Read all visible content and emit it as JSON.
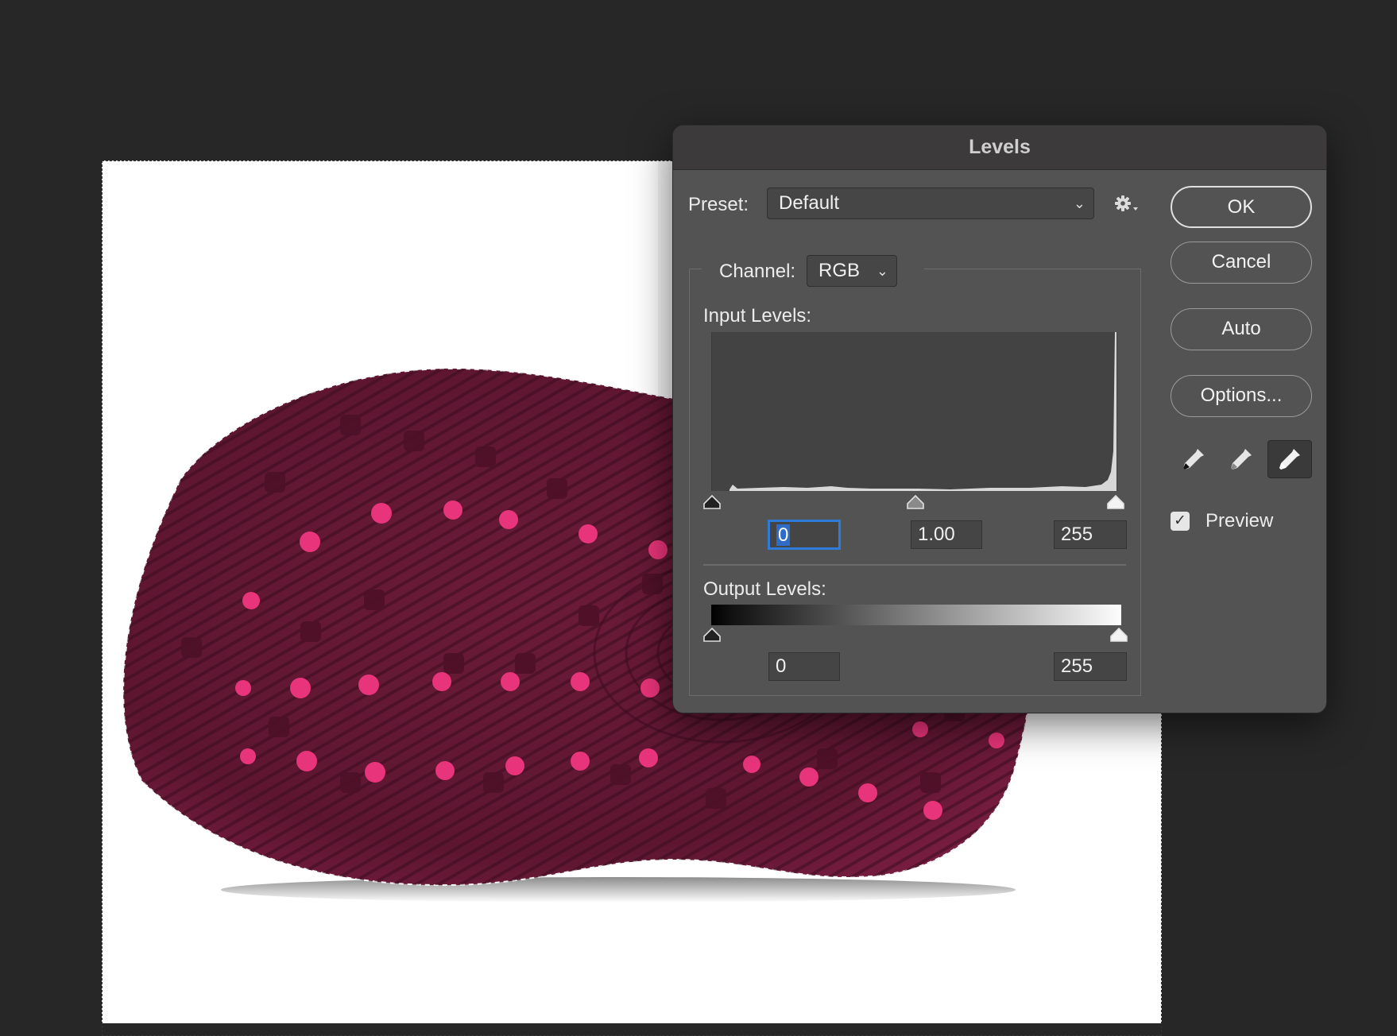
{
  "dialog": {
    "title": "Levels",
    "preset_label": "Preset:",
    "preset_value": "Default",
    "channel_label": "Channel:",
    "channel_value": "RGB",
    "input_levels_label": "Input Levels:",
    "input_black": "0",
    "input_gamma": "1.00",
    "input_white": "255",
    "output_levels_label": "Output Levels:",
    "output_black": "0",
    "output_white": "255",
    "buttons": {
      "ok": "OK",
      "cancel": "Cancel",
      "auto": "Auto",
      "options": "Options..."
    },
    "preview_label": "Preview",
    "preview_checked": true,
    "icons": {
      "gear": "gear-icon",
      "black_eyedropper": "eyedropper-black-icon",
      "gray_eyedropper": "eyedropper-gray-icon",
      "white_eyedropper": "eyedropper-white-icon"
    }
  },
  "colors": {
    "workspace": "#272727",
    "dialog_bg": "#535353",
    "titlebar_bg": "#3c3a3b",
    "focus_ring": "#2f7bd8",
    "outsole": "#6e1d3a",
    "outsole_lugs": "#e8347a"
  }
}
